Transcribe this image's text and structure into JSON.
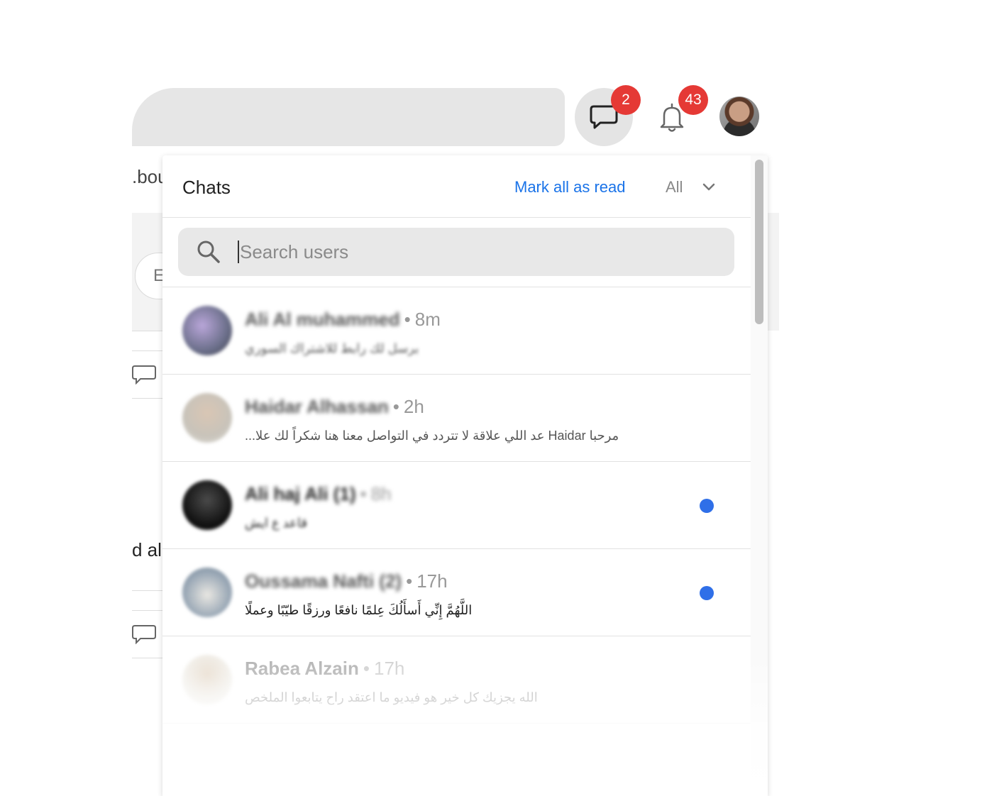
{
  "background": {
    "partial_text_1": ".bou",
    "partial_text_2": "d al",
    "partial_button": "E"
  },
  "header_icons": {
    "chat_icon": "chat-bubble-icon",
    "chat_badge": "2",
    "bell_icon": "bell-icon",
    "bell_badge": "43",
    "badge_color": "#e53935"
  },
  "chats_panel": {
    "title": "Chats",
    "mark_all_read": "Mark all as read",
    "filter": {
      "selected": "All",
      "icon": "chevron-down-icon"
    },
    "search": {
      "placeholder": "Search users",
      "icon": "search-icon"
    },
    "accent_color": "#1a73e8",
    "unread_color": "#2f6fe8",
    "items": [
      {
        "name": "Ali Al muhammed",
        "time": "8m",
        "preview": "برسل لك رابط للاشتراك السوري",
        "unread": false
      },
      {
        "name": "Haidar Alhassan",
        "time": "2h",
        "preview": "مرحبا Haidar عد اللي علاقة لا تتردد في التواصل معنا هنا شكراً لك علا...",
        "unread": false
      },
      {
        "name": "Ali haj Ali (1)",
        "time": "8h",
        "preview": "قاعد ع ايش",
        "unread": true
      },
      {
        "name": "Oussama Nafti (2)",
        "time": "17h",
        "preview": "اللَّهُمَّ إِنِّي أَسأَلُكَ عِلمًا نافعًا ورزقًا طيّبًا وعملًا",
        "unread": true
      },
      {
        "name": "Rabea Alzain",
        "time": "17h",
        "preview": "الله يجزيك كل خير هو فيديو ما اعتقد راح يتابعوا الملخص",
        "unread": false
      }
    ]
  }
}
